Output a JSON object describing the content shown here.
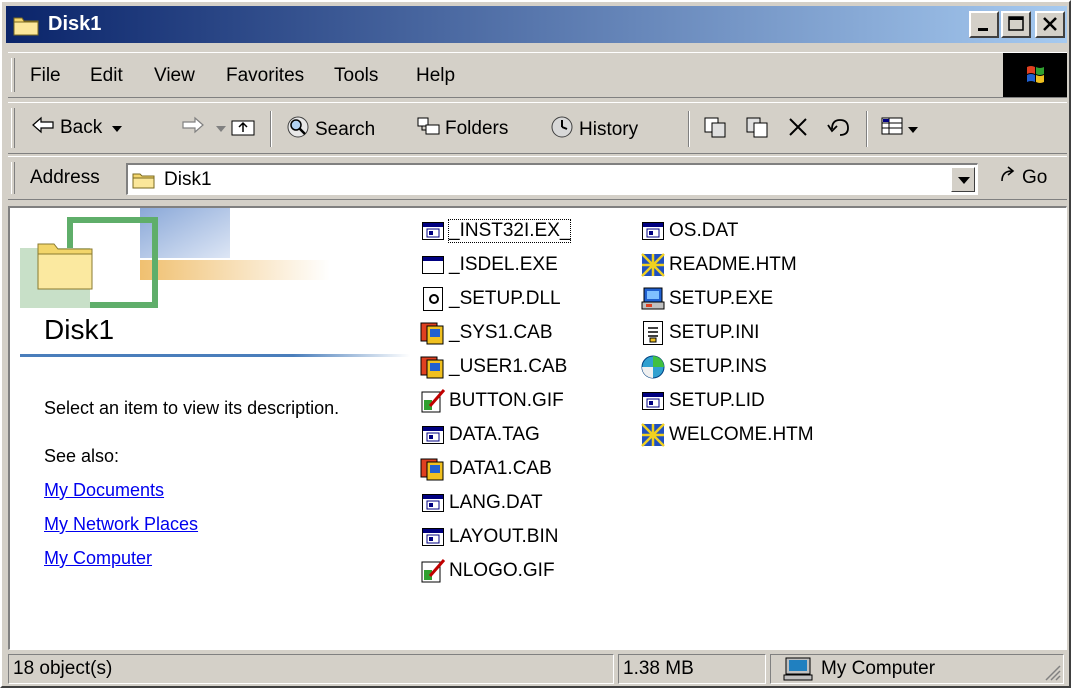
{
  "window": {
    "title": "Disk1"
  },
  "menu": {
    "items": [
      "File",
      "Edit",
      "View",
      "Favorites",
      "Tools",
      "Help"
    ]
  },
  "toolbar": {
    "back_label": "Back",
    "search_label": "Search",
    "folders_label": "Folders",
    "history_label": "History"
  },
  "address": {
    "label": "Address",
    "value": "Disk1",
    "go_label": "Go"
  },
  "webview": {
    "folder_name": "Disk1",
    "description": "Select an item to view its description.",
    "see_also": "See also:",
    "links": [
      "My Documents",
      "My Network Places",
      "My Computer"
    ]
  },
  "files": {
    "col1": [
      "_INST32I.EX_",
      "_ISDEL.EXE",
      "_SETUP.DLL",
      "_SYS1.CAB",
      "_USER1.CAB",
      "BUTTON.GIF",
      "DATA.TAG",
      "DATA1.CAB",
      "LANG.DAT",
      "LAYOUT.BIN",
      "NLOGO.GIF"
    ],
    "col2": [
      "OS.DAT",
      "README.HTM",
      "SETUP.EXE",
      "SETUP.INI",
      "SETUP.INS",
      "SETUP.LID",
      "WELCOME.HTM"
    ]
  },
  "status": {
    "count": "18 object(s)",
    "size": "1.38 MB",
    "zone": "My Computer"
  },
  "colors": {
    "title_start": "#0a246a",
    "title_end": "#a6caf0",
    "link": "#0000ee",
    "face": "#d4d0c8"
  }
}
